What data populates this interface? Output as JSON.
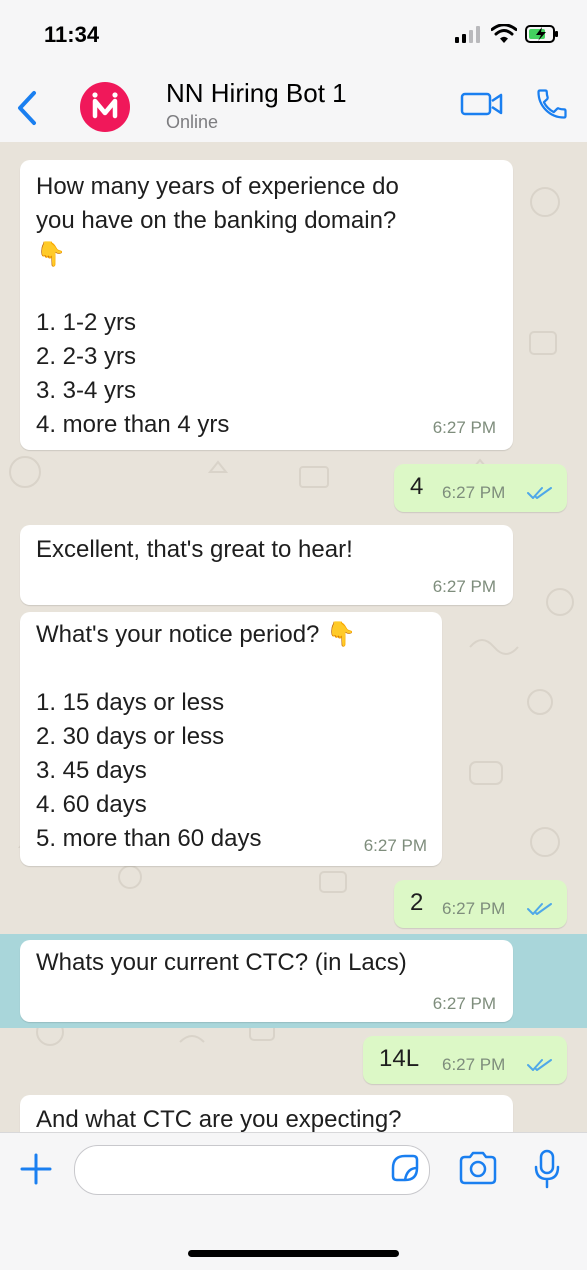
{
  "status_bar": {
    "time": "11:34"
  },
  "header": {
    "title": "NN Hiring Bot 1",
    "subtitle": "Online"
  },
  "messages": [
    {
      "direction": "incoming",
      "text": "How many years of experience do\nyou have on the banking domain?\n👇\n\n1. 1-2 yrs\n2. 2-3 yrs\n3. 3-4 yrs\n4. more than 4 yrs",
      "time": "6:27 PM"
    },
    {
      "direction": "outgoing",
      "text": "4",
      "time": "6:27 PM",
      "status": "read"
    },
    {
      "direction": "incoming",
      "text": "Excellent, that's great to hear!",
      "time": "6:27 PM"
    },
    {
      "direction": "incoming",
      "text": "What's your notice period? 👇\n\n1. 15 days or less\n2. 30 days or less\n3. 45 days\n4. 60 days\n5. more than 60 days",
      "time": "6:27 PM"
    },
    {
      "direction": "outgoing",
      "text": "2",
      "time": "6:27 PM",
      "status": "read"
    },
    {
      "direction": "incoming",
      "text": "Whats your current CTC? (in Lacs)",
      "time": "6:27 PM",
      "highlighted": true
    },
    {
      "direction": "outgoing",
      "text": "14L",
      "time": "6:27 PM",
      "status": "read"
    },
    {
      "direction": "incoming",
      "text": "And what CTC are you expecting?",
      "time": ""
    }
  ],
  "colors": {
    "accent": "#1a7ff0",
    "outgoing_bubble": "#dcf8c6",
    "incoming_bubble": "#ffffff",
    "avatar": "#f0185a",
    "highlight": "#a9d6da",
    "read_ticks": "#4fa8e8"
  },
  "icons": [
    "back-chevron-icon",
    "video-call-icon",
    "phone-call-icon",
    "plus-icon",
    "sticker-icon",
    "camera-icon",
    "mic-icon",
    "signal-icon",
    "wifi-icon",
    "battery-icon"
  ]
}
